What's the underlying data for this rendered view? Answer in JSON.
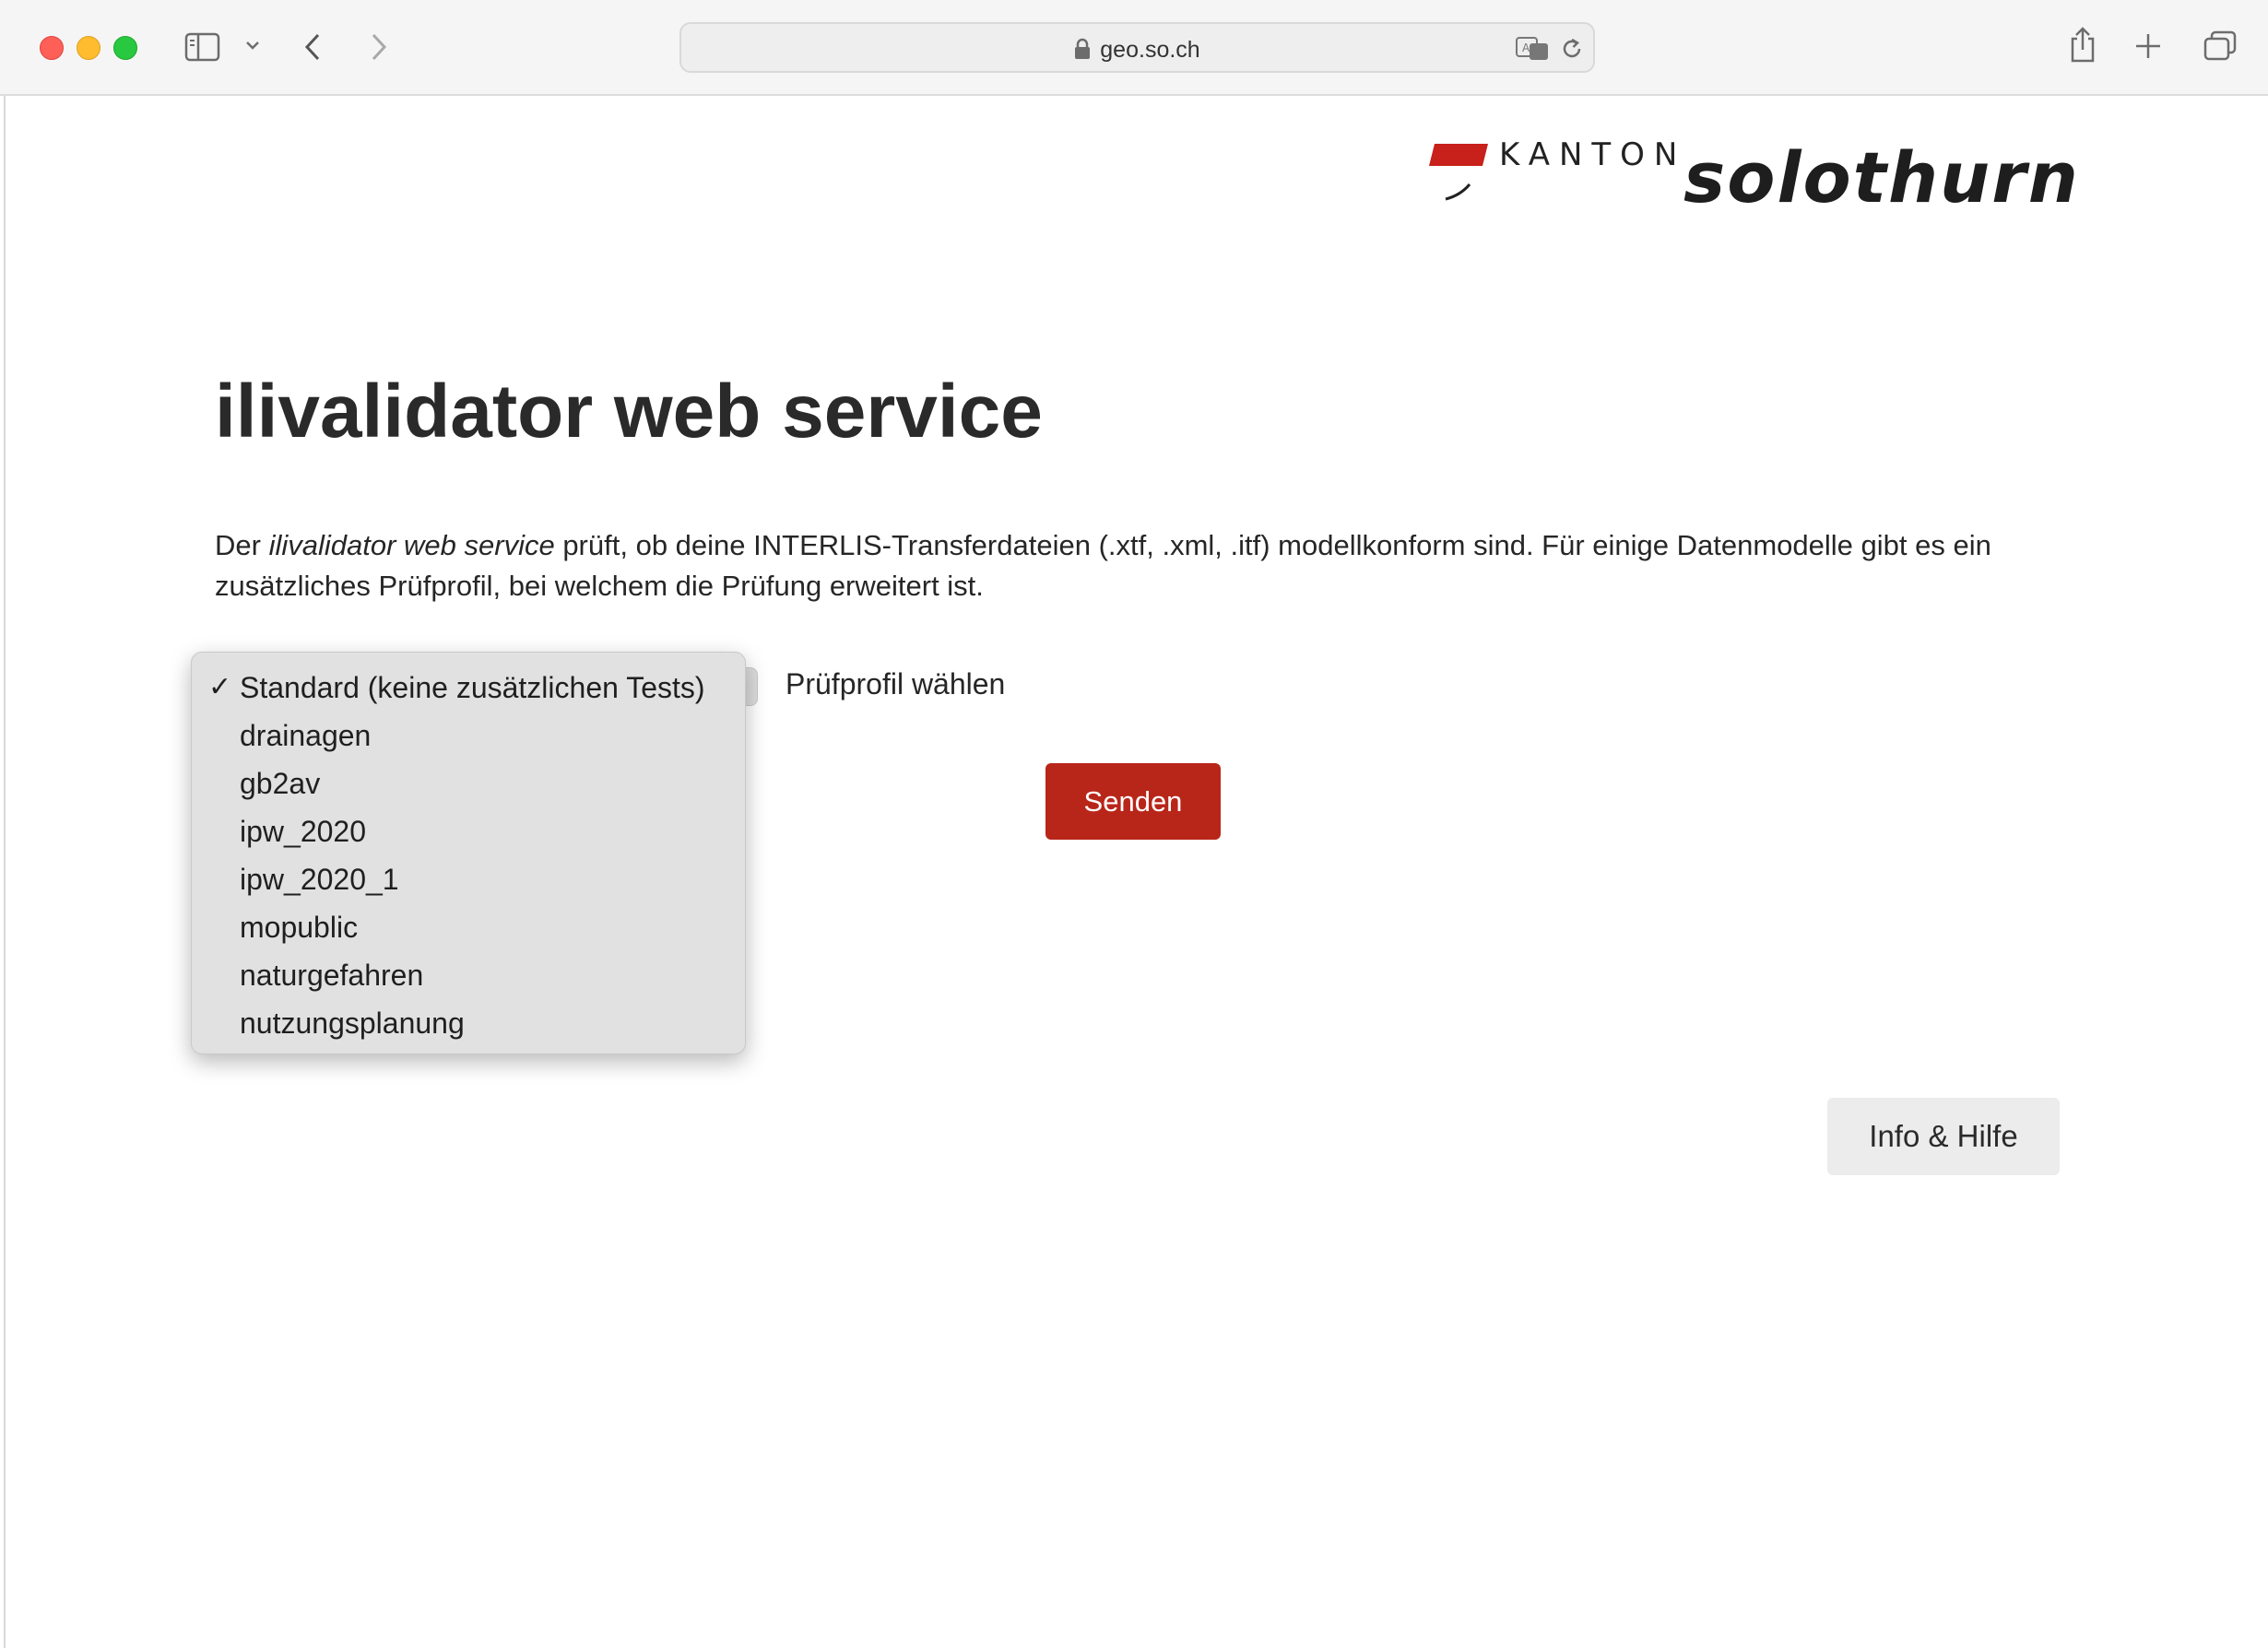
{
  "browser": {
    "url": "geo.so.ch",
    "icons": [
      "sidebar-icon",
      "chevron-down-icon",
      "back-icon",
      "forward-icon",
      "lock-icon",
      "translate-icon",
      "reload-icon",
      "share-icon",
      "new-tab-icon",
      "tabs-overview-icon"
    ]
  },
  "logo": {
    "kanton": "KANTON",
    "name": "solothurn",
    "accent_color": "#c8201a"
  },
  "page": {
    "title": "ilivalidator web service",
    "intro_prefix": "Der ",
    "intro_em": "ilivalidator web service",
    "intro_rest": " prüft, ob deine INTERLIS-Transferdateien (.xtf, .xml, .itf) modellkonform sind. Für einige Datenmodelle gibt es ein zusätzliches Prüfprofil, bei welchem die Prüfung erweitert ist."
  },
  "form": {
    "profile_label": "Prüfprofil wählen",
    "selected_index": 0,
    "options": [
      "Standard (keine zusätzlichen Tests)",
      "drainagen",
      "gb2av",
      "ipw_2020",
      "ipw_2020_1",
      "mopublic",
      "naturgefahren",
      "nutzungsplanung"
    ],
    "send_label": "Senden",
    "send_color": "#b8261a"
  },
  "footer": {
    "help_label": "Info & Hilfe"
  }
}
